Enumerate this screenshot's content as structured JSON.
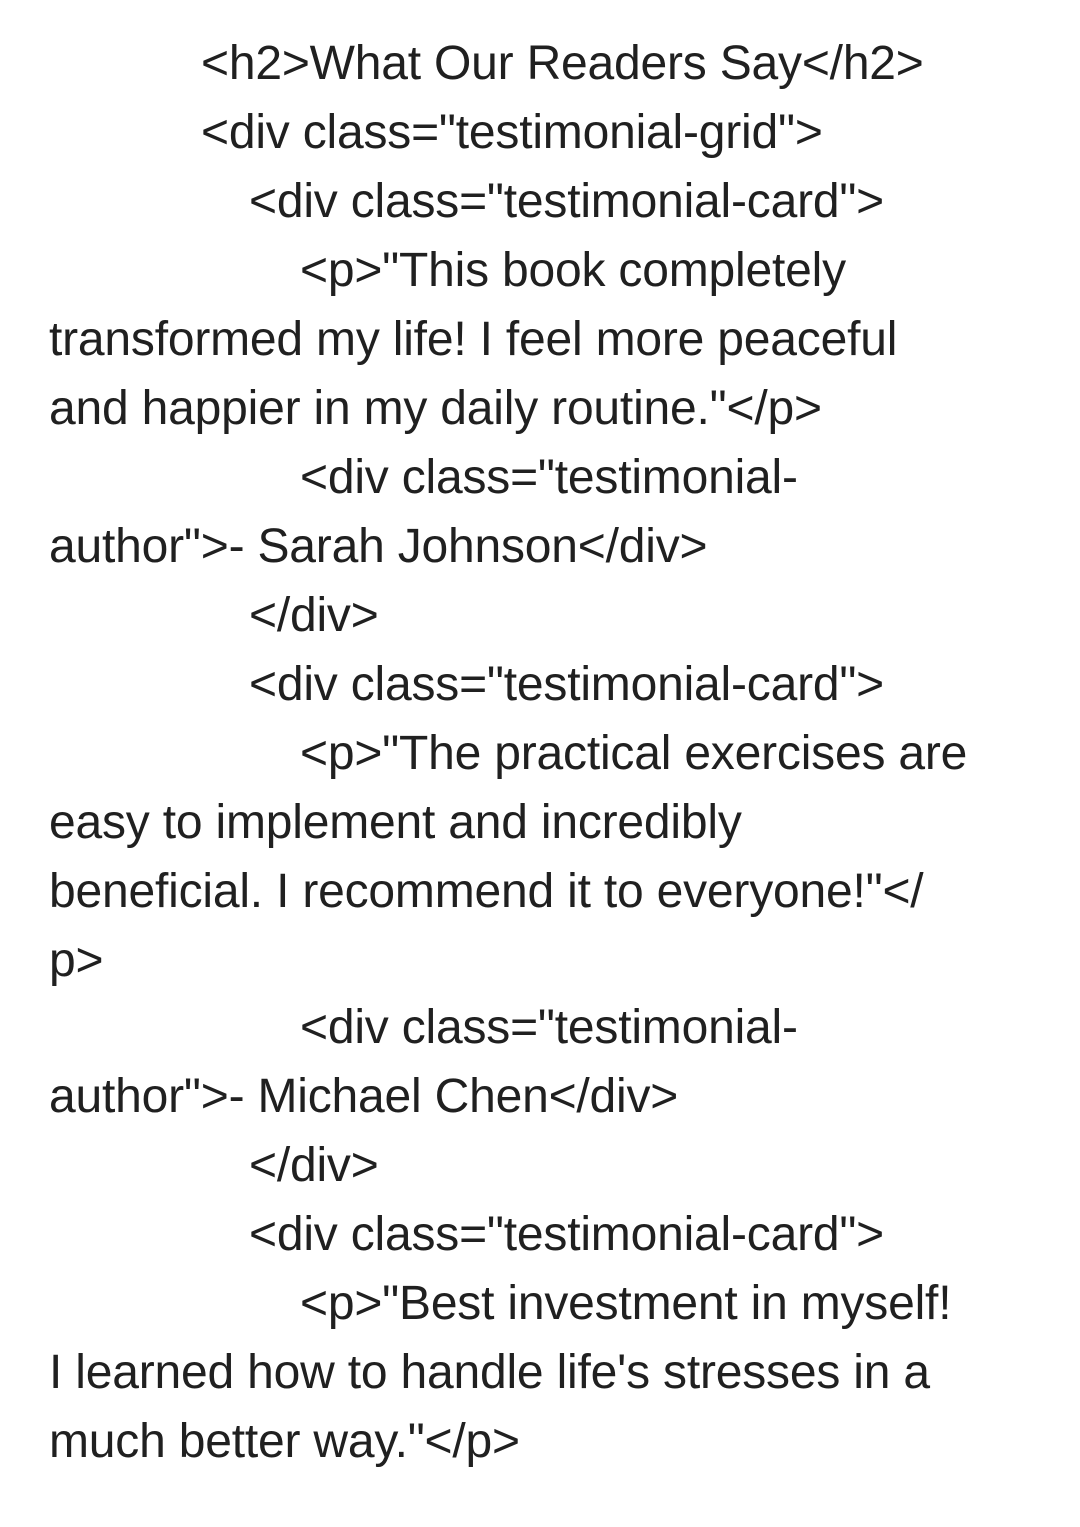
{
  "lines": [
    "<h2>What Our Readers Say</h2>",
    "<div class=\"testimonial-grid\">",
    "<div class=\"testimonial-card\">",
    "<p>\"This book completely",
    "transformed my life! I feel more peaceful",
    "and happier in my daily routine.\"</p>",
    "<div class=\"testimonial-",
    "author\">- Sarah Johnson</div>",
    "</div>",
    "<div class=\"testimonial-card\">",
    "<p>\"The practical exercises are",
    "easy to implement and incredibly",
    "beneficial. I recommend it to everyone!\"</",
    "p>",
    "<div class=\"testimonial-",
    "author\">- Michael Chen</div>",
    "</div>",
    "<div class=\"testimonial-card\">",
    "<p>\"Best investment in myself!",
    "I learned how to handle life's stresses in a",
    "much better way.\"</p>"
  ]
}
